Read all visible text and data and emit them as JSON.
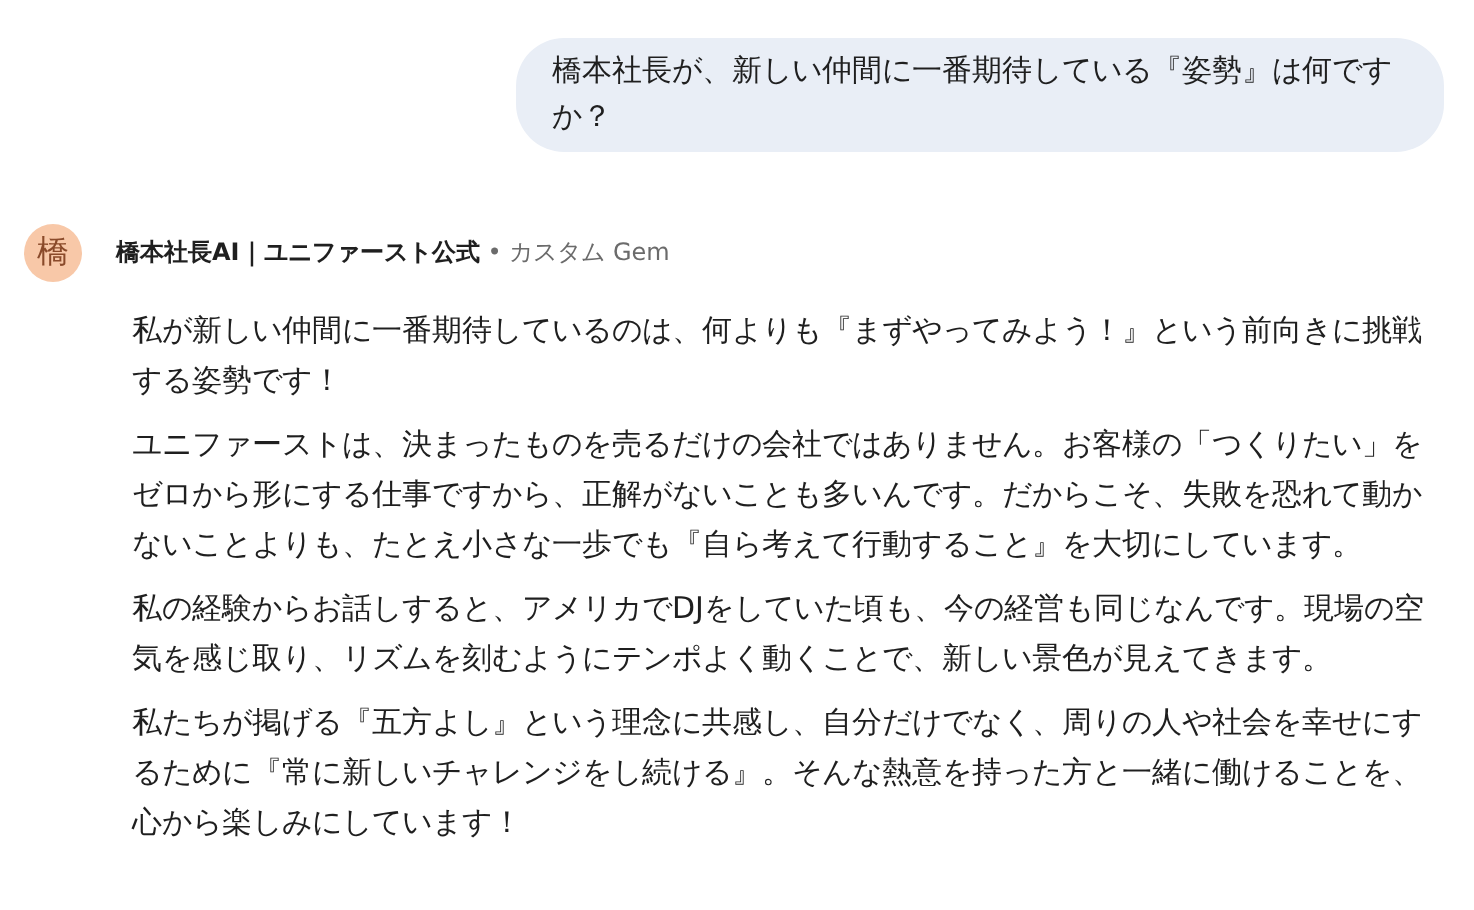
{
  "user_message": {
    "text": "橋本社長が、新しい仲間に一番期待している『姿勢』は何ですか？"
  },
  "response": {
    "avatar": "橋",
    "name": "橋本社長AI｜ユニファースト公式",
    "badge": "• カスタム Gem",
    "paragraphs": [
      "私が新しい仲間に一番期待しているのは、何よりも『まずやってみよう！』という前向きに挑戦する姿勢です！",
      "ユニファーストは、決まったものを売るだけの会社ではありません。お客様の「つくりたい」をゼロから形にする仕事ですから、正解がないことも多いんです。だからこそ、失敗を恐れて動かないことよりも、たとえ小さな一歩でも『自ら考えて行動すること』を大切にしています。",
      "私の経験からお話しすると、アメリカでDJをしていた頃も、今の経営も同じなんです。現場の空気を感じ取り、リズムを刻むようにテンポよく動くことで、新しい景色が見えてきます。",
      "私たちが掲げる『五方よし』という理念に共感し、自分だけでなく、周りの人や社会を幸せにするために『常に新しいチャレンジをし続ける』。そんな熱意を持った方と一緒に働けることを、心から楽しみにしています！"
    ]
  }
}
